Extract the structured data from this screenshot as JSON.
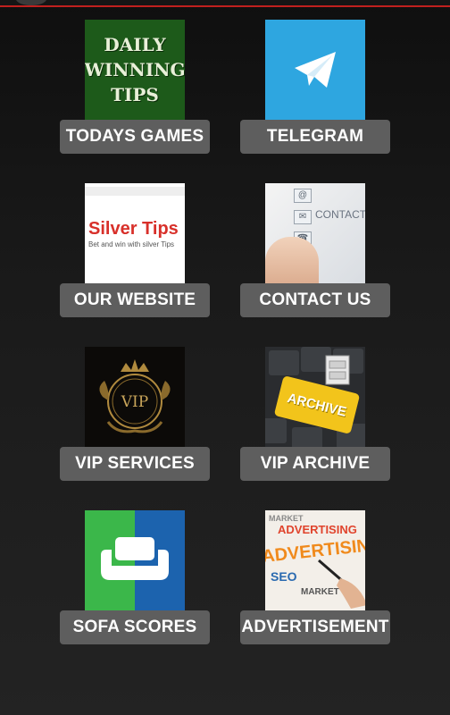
{
  "tiles": [
    {
      "label": "TODAYS GAMES",
      "thumb_text": [
        "DAILY",
        "WINNING",
        "TIPS"
      ]
    },
    {
      "label": "TELEGRAM"
    },
    {
      "label": "OUR WEBSITE",
      "thumb_title": "Silver Tips",
      "thumb_tagline": "Bet and win with silver Tips"
    },
    {
      "label": "CONTACT US",
      "thumb_text": "CONTACT"
    },
    {
      "label": "VIP SERVICES",
      "thumb_text": "VIP"
    },
    {
      "label": "VIP ARCHIVE",
      "thumb_text": "ARCHIVE"
    },
    {
      "label": "SOFA SCORES"
    },
    {
      "label": "ADVERTISEMENT",
      "thumb_words": [
        "ADVERTISING",
        "MARKET",
        "SEO"
      ]
    }
  ],
  "colors": {
    "button_bg": "#5e5e5e",
    "accent_bar": "#c0201e",
    "telegram": "#2ea6e0",
    "sofa_green": "#3bb74a",
    "sofa_blue": "#1c63ae"
  },
  "icons": {
    "telegram": "paper-plane-icon",
    "sofa": "sofa-icon",
    "contact": "at-sign-icon"
  }
}
